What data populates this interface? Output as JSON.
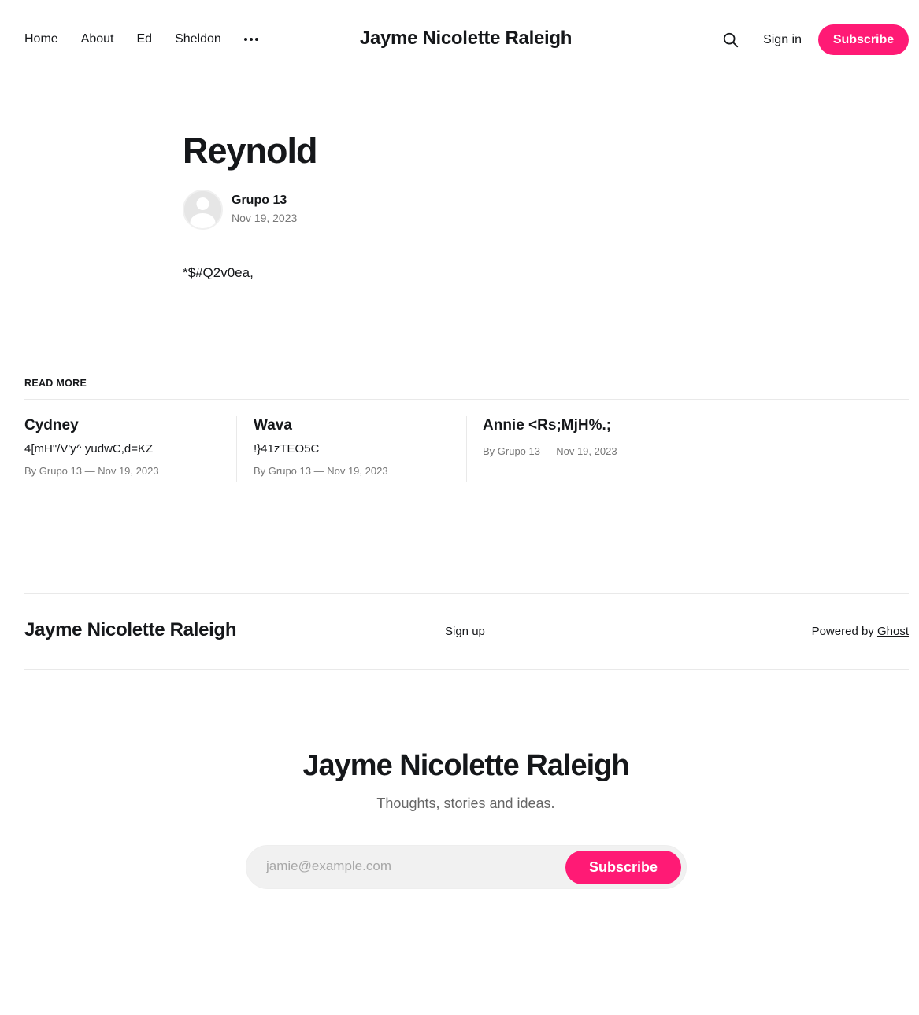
{
  "header": {
    "nav": [
      "Home",
      "About",
      "Ed",
      "Sheldon"
    ],
    "site_title": "Jayme Nicolette Raleigh",
    "signin": "Sign in",
    "subscribe": "Subscribe"
  },
  "article": {
    "title": "Reynold",
    "author": "Grupo 13",
    "date": "Nov 19, 2023",
    "body": "*$#Q2v0ea,"
  },
  "read_more": {
    "label": "READ MORE",
    "cards": [
      {
        "title": "Cydney",
        "excerpt": "4[mH\"/V'y^ yudwC,d=KZ",
        "meta": "By Grupo 13 — Nov 19, 2023"
      },
      {
        "title": "Wava",
        "excerpt": "!}41zTEO5C",
        "meta": "By Grupo 13 — Nov 19, 2023"
      },
      {
        "title": "Annie <Rs;MjH%.;",
        "excerpt": "",
        "meta": "By Grupo 13 — Nov 19, 2023"
      }
    ]
  },
  "footer": {
    "title": "Jayme Nicolette Raleigh",
    "signup": "Sign up",
    "powered_prefix": "Powered by ",
    "powered_link": "Ghost"
  },
  "cta": {
    "title": "Jayme Nicolette Raleigh",
    "description": "Thoughts, stories and ideas.",
    "placeholder": "jamie@example.com",
    "button": "Subscribe"
  },
  "colors": {
    "accent": "#ff1a75",
    "text": "#15171a",
    "muted": "#777777"
  },
  "icons": {
    "search": "search-icon",
    "more": "more-dots-icon",
    "avatar": "avatar-placeholder-icon"
  }
}
